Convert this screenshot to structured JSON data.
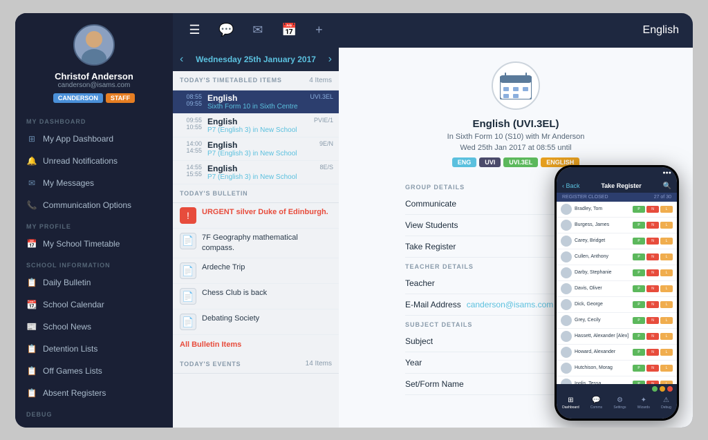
{
  "app": {
    "title": "English"
  },
  "sidebar": {
    "user": {
      "name": "Christof Anderson",
      "email": "canderson@isams.com",
      "badge1": "CANDERSON",
      "badge2": "STAFF"
    },
    "sections": [
      {
        "label": "MY DASHBOARD",
        "items": [
          {
            "id": "app-dashboard",
            "text": "My App Dashboard",
            "icon": "⊞",
            "active": false
          },
          {
            "id": "unread-notifications",
            "text": "Unread Notifications",
            "icon": "🔔",
            "active": false
          },
          {
            "id": "my-messages",
            "text": "My Messages",
            "icon": "✉",
            "active": false
          },
          {
            "id": "communication-options",
            "text": "Communication Options",
            "icon": "📞",
            "active": false
          }
        ]
      },
      {
        "label": "MY PROFILE",
        "items": [
          {
            "id": "school-timetable",
            "text": "My School Timetable",
            "icon": "📅",
            "active": false
          }
        ]
      },
      {
        "label": "SCHOOL INFORMATION",
        "items": [
          {
            "id": "daily-bulletin",
            "text": "Daily Bulletin",
            "icon": "📋",
            "active": false
          },
          {
            "id": "school-calendar",
            "text": "School Calendar",
            "icon": "📆",
            "active": false
          },
          {
            "id": "school-news",
            "text": "School News",
            "icon": "📰",
            "active": false
          },
          {
            "id": "detention-lists",
            "text": "Detention Lists",
            "icon": "📋",
            "active": false
          },
          {
            "id": "off-games-lists",
            "text": "Off Games Lists",
            "icon": "📋",
            "active": false
          },
          {
            "id": "absent-registers",
            "text": "Absent Registers",
            "icon": "📋",
            "active": false
          }
        ]
      },
      {
        "label": "DEBUG",
        "items": []
      }
    ]
  },
  "middle": {
    "nav_icons": [
      "☰",
      "💬",
      "✉",
      "📅",
      "+"
    ],
    "date": "Wednesday 25th January 2017",
    "timetable": {
      "label": "TODAY'S TIMETABLED ITEMS",
      "count": "4 Items",
      "items": [
        {
          "start": "08:55",
          "end": "09:55",
          "subject": "English",
          "detail": "Sixth Form 10 in Sixth Centre",
          "code": "UVI.3EL",
          "active": true
        },
        {
          "start": "09:55",
          "end": "10:55",
          "subject": "English",
          "detail": "P7 (English 3) in New School",
          "code": "PVIE/1",
          "active": false
        },
        {
          "start": "14:00",
          "end": "14:55",
          "subject": "English",
          "detail": "P7 (English 3) in New School",
          "code": "9E/N",
          "active": false
        },
        {
          "start": "14:55",
          "end": "15:55",
          "subject": "English",
          "detail": "P7 (English 3) in New School",
          "code": "8E/S",
          "active": false
        }
      ]
    },
    "bulletin": {
      "label": "TODAY'S BULLETIN",
      "items": [
        {
          "type": "urgent",
          "text": "URGENT silver Duke of Edinburgh."
        },
        {
          "type": "normal",
          "text": "7F Geography mathematical compass."
        },
        {
          "type": "normal",
          "text": "Ardeche Trip"
        },
        {
          "type": "normal",
          "text": "Chess Club is back"
        },
        {
          "type": "normal",
          "text": "Debating Society"
        }
      ],
      "all_link": "All Bulletin Items"
    },
    "events": {
      "label": "TODAY'S EVENTS",
      "count": "14 Items"
    }
  },
  "main": {
    "class": {
      "name": "English (UVI.3EL)",
      "subtitle": "In Sixth Form 10 (S10) with Mr Anderson",
      "time": "Wed 25th Jan 2017 at 08:55 until",
      "tags": [
        "ENG",
        "UVI",
        "UVI.3EL",
        "ENGLISH"
      ]
    },
    "group_details": {
      "label": "GROUP DETAILS",
      "items": [
        "Communicate",
        "View Students",
        "Take Register"
      ]
    },
    "teacher_details": {
      "label": "TEACHER DETAILS",
      "teacher_label": "Teacher",
      "email_label": "E-Mail Address",
      "email": "canderson@isams.com"
    },
    "subject_details": {
      "label": "SUBJECT DETAILS",
      "items": [
        "Subject",
        "Year",
        "Set/Form Name"
      ]
    }
  },
  "phone": {
    "header": {
      "back": "< Back",
      "title": "Take Register",
      "search_icon": "🔍"
    },
    "register_header": {
      "label": "REGISTER CLOSED",
      "date": "27 of 30"
    },
    "students": [
      {
        "name": "Bradley, Tom"
      },
      {
        "name": "Burgess, James"
      },
      {
        "name": "Carey, Bridget"
      },
      {
        "name": "Cullen, Anthony"
      },
      {
        "name": "Darby, Stephanie"
      },
      {
        "name": "Davis, Oliver"
      },
      {
        "name": "Dick, George"
      },
      {
        "name": "Grey, Cecily"
      },
      {
        "name": "Hassett, Alexander [Alex]"
      },
      {
        "name": "Howard, Alexander"
      },
      {
        "name": "Hutchison, Morag"
      },
      {
        "name": "Inglis, Tessa"
      }
    ],
    "nav_items": [
      {
        "icon": "⊞",
        "label": "Dashboard",
        "active": true
      },
      {
        "icon": "💬",
        "label": "Comms",
        "active": false
      },
      {
        "icon": "⚙",
        "label": "Settings",
        "active": false
      },
      {
        "icon": "✦",
        "label": "Wizards",
        "active": false
      },
      {
        "icon": "⚠",
        "label": "Debug",
        "active": false
      }
    ],
    "color_dots": [
      "#5cb85c",
      "#e7a020",
      "#e74c3c"
    ]
  }
}
